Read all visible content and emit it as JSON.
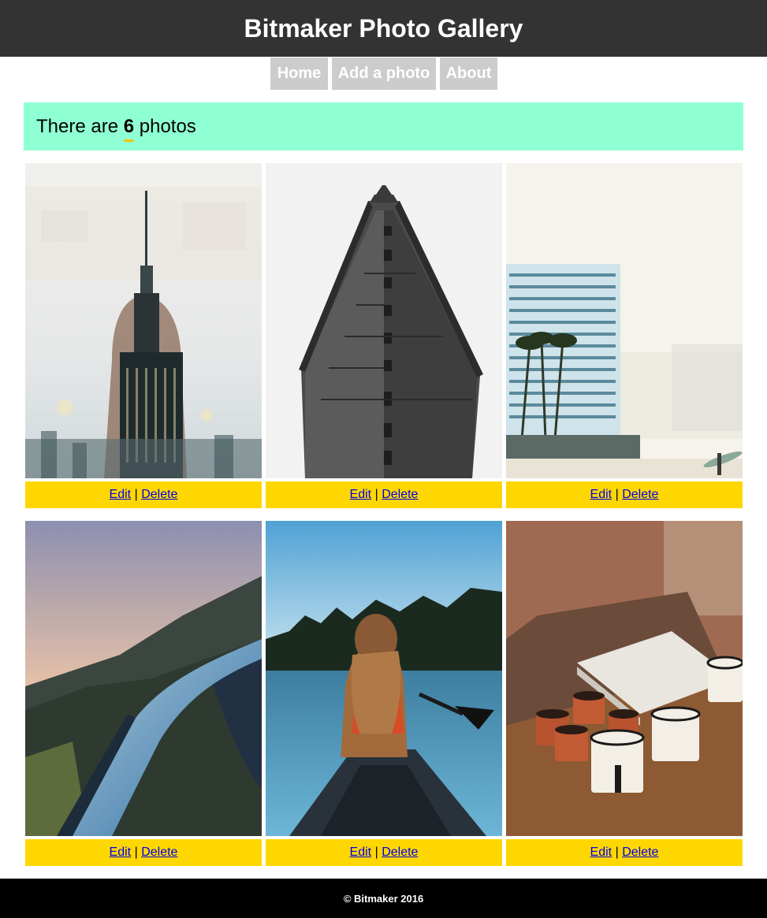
{
  "header": {
    "title": "Bitmaker Photo Gallery"
  },
  "nav": {
    "home": "Home",
    "add": "Add a photo",
    "about": "About"
  },
  "banner": {
    "prefix": "There are ",
    "count": "6",
    "suffix": " photos"
  },
  "photos": [
    {
      "subject": "double-exposure-skyline",
      "edit": "Edit",
      "sep": "|",
      "delete": "Delete"
    },
    {
      "subject": "flatiron-building",
      "edit": "Edit",
      "sep": "|",
      "delete": "Delete"
    },
    {
      "subject": "beach-hotel-surfer",
      "edit": "Edit",
      "sep": "|",
      "delete": "Delete"
    },
    {
      "subject": "coastal-road",
      "edit": "Edit",
      "sep": "|",
      "delete": "Delete"
    },
    {
      "subject": "canoe-lake",
      "edit": "Edit",
      "sep": "|",
      "delete": "Delete"
    },
    {
      "subject": "enamel-mugs",
      "edit": "Edit",
      "sep": "|",
      "delete": "Delete"
    }
  ],
  "footer": {
    "text": "© Bitmaker 2016"
  },
  "colors": {
    "header": "#333333",
    "nav": "#cccccc",
    "banner": "#8fffd4",
    "actions": "#ffd700",
    "footer": "#000000"
  }
}
